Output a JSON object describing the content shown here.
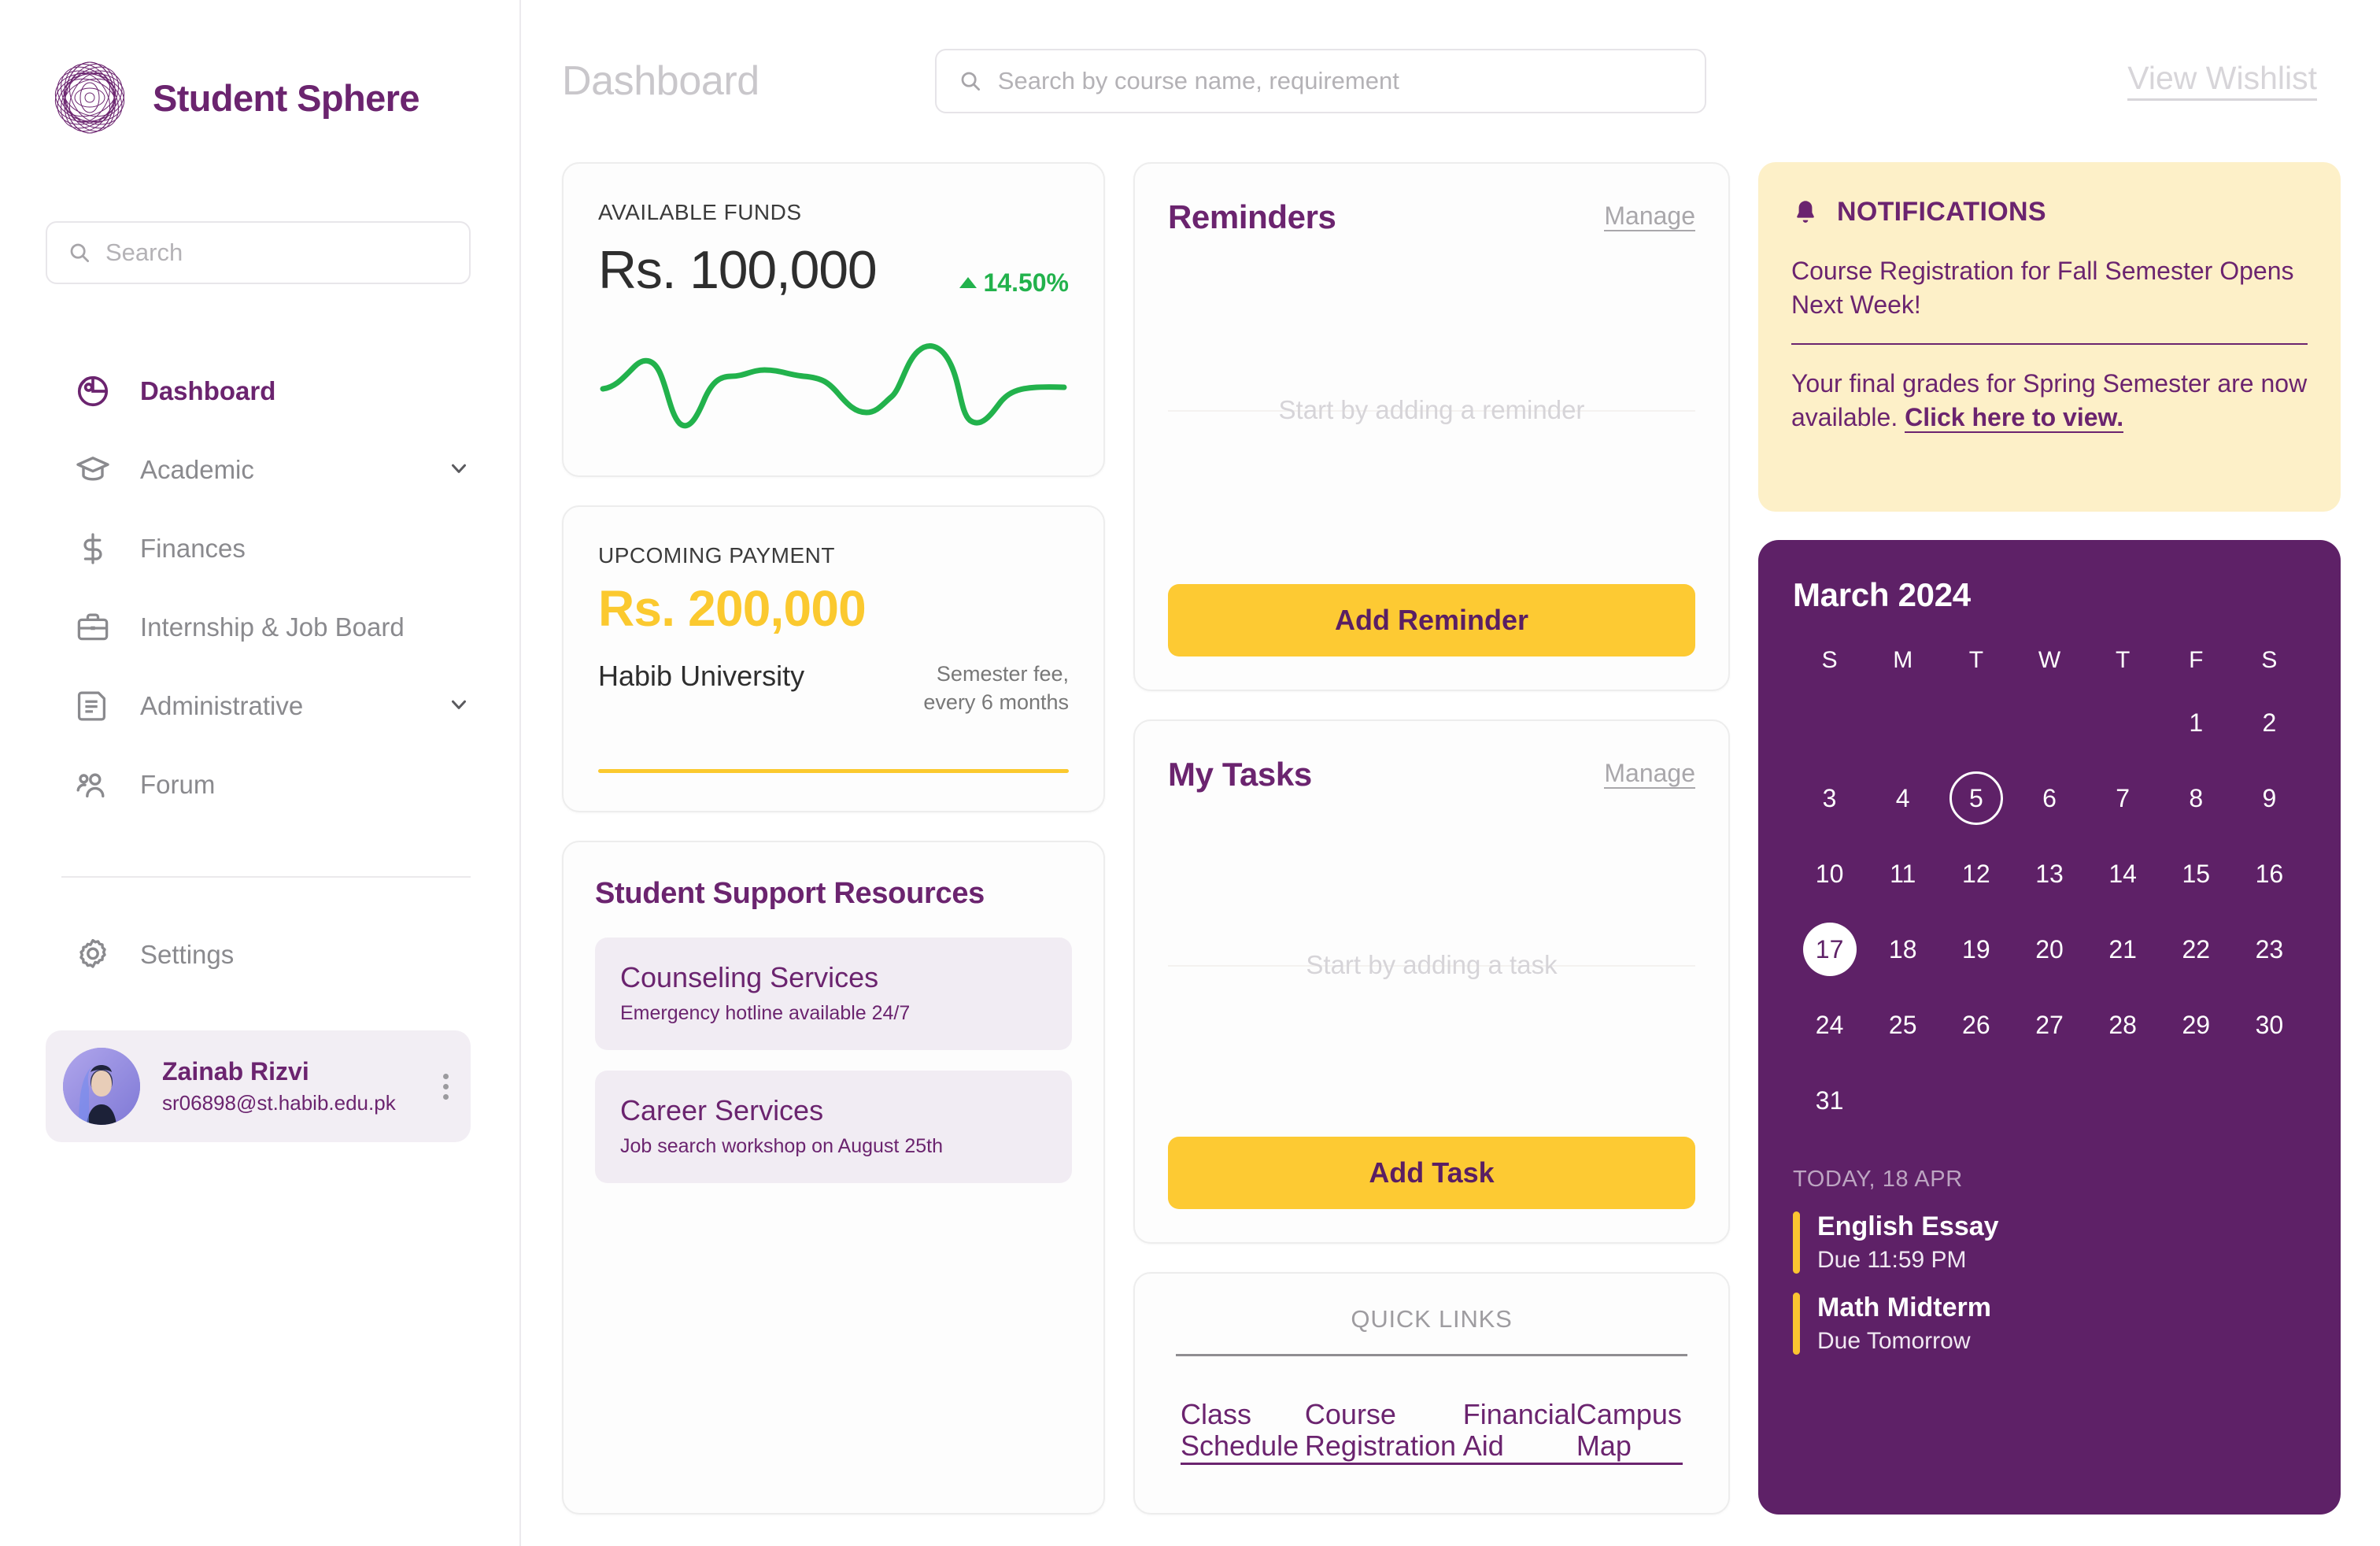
{
  "brand": {
    "name": "Student Sphere",
    "logo_icon": "spirograph-logo"
  },
  "sidebar": {
    "search": {
      "placeholder": "Search",
      "icon": "search-icon"
    },
    "items": [
      {
        "label": "Dashboard",
        "icon": "pie-chart-icon",
        "active": true,
        "chevron": false
      },
      {
        "label": "Academic",
        "icon": "graduation-cap-icon",
        "active": false,
        "chevron": true
      },
      {
        "label": "Finances",
        "icon": "dollar-sign-icon",
        "active": false,
        "chevron": false
      },
      {
        "label": "Internship & Job Board",
        "icon": "briefcase-icon",
        "active": false,
        "chevron": false
      },
      {
        "label": "Administrative",
        "icon": "document-icon",
        "active": false,
        "chevron": true
      },
      {
        "label": "Forum",
        "icon": "people-icon",
        "active": false,
        "chevron": false
      }
    ],
    "settings": {
      "label": "Settings",
      "icon": "gear-icon"
    },
    "user": {
      "name": "Zainab Rizvi",
      "email": "sr06898@st.habib.edu.pk",
      "menu_icon": "kebab-menu-icon"
    }
  },
  "header": {
    "title": "Dashboard",
    "search": {
      "placeholder": "Search by course name, requirement",
      "icon": "search-icon"
    },
    "wishlist_label": "View Wishlist"
  },
  "funds": {
    "label": "AVAILABLE FUNDS",
    "amount": "Rs. 100,000",
    "delta": "14.50%",
    "delta_direction": "up",
    "delta_color": "#22b24c"
  },
  "payment": {
    "label": "UPCOMING PAYMENT",
    "amount": "Rs. 200,000",
    "institution": "Habib University",
    "note_line1": "Semester fee,",
    "note_line2": "every 6 months",
    "accent_color": "#FBC92F"
  },
  "support": {
    "title": "Student Support Resources",
    "items": [
      {
        "title": "Counseling Services",
        "subtitle": "Emergency hotline available 24/7"
      },
      {
        "title": "Career Services",
        "subtitle": "Job search workshop on August 25th"
      }
    ]
  },
  "reminders": {
    "title": "Reminders",
    "manage_label": "Manage",
    "empty_text": "Start by adding a reminder",
    "button_label": "Add Reminder"
  },
  "tasks": {
    "title": "My Tasks",
    "manage_label": "Manage",
    "empty_text": "Start by adding a task",
    "button_label": "Add Task"
  },
  "quick_links": {
    "title": "QUICK LINKS",
    "links": [
      "Class Schedule",
      "Course Registration",
      "Financial Aid",
      "Campus Map"
    ]
  },
  "notifications": {
    "title": "NOTIFICATIONS",
    "icon": "bell-icon",
    "background": "#FDF0C8",
    "items": [
      {
        "text": "Course Registration for Fall Semester Opens Next Week!",
        "link": ""
      },
      {
        "text": "Your final grades for Spring Semester are now available. ",
        "link": "Click here to view."
      }
    ]
  },
  "calendar": {
    "month_label": "March 2024",
    "background": "#5E2167",
    "weekdays": [
      "S",
      "M",
      "T",
      "W",
      "T",
      "F",
      "S"
    ],
    "lead_blanks": 5,
    "days": [
      1,
      2,
      3,
      4,
      5,
      6,
      7,
      8,
      9,
      10,
      11,
      12,
      13,
      14,
      15,
      16,
      17,
      18,
      19,
      20,
      21,
      22,
      23,
      24,
      25,
      26,
      27,
      28,
      29,
      30,
      31
    ],
    "selected_day": 5,
    "today_day": 17,
    "today_label": "TODAY, 18 APR",
    "events": [
      {
        "title": "English Essay",
        "due": "Due 11:59 PM"
      },
      {
        "title": "Math Midterm",
        "due": "Due Tomorrow"
      }
    ]
  },
  "chart_data": {
    "type": "line",
    "title": "Available Funds trend",
    "x": [
      0,
      1,
      2,
      3,
      4,
      5,
      6,
      7,
      8,
      9,
      10,
      11,
      12,
      13,
      14,
      15,
      16,
      17,
      18,
      19,
      20
    ],
    "values": [
      62,
      62,
      70,
      72,
      58,
      30,
      28,
      52,
      62,
      66,
      66,
      62,
      48,
      46,
      38,
      46,
      58,
      88,
      90,
      58,
      34,
      62,
      62
    ],
    "series": [
      {
        "name": "Available Funds",
        "color": "#22b24c",
        "values": [
          62,
          66,
          72,
          70,
          40,
          28,
          34,
          56,
          64,
          66,
          64,
          58,
          48,
          46,
          40,
          46,
          62,
          86,
          90,
          62,
          34,
          50,
          62
        ]
      }
    ],
    "xlabel": "",
    "ylabel": "",
    "grid": false,
    "legend": "none"
  }
}
